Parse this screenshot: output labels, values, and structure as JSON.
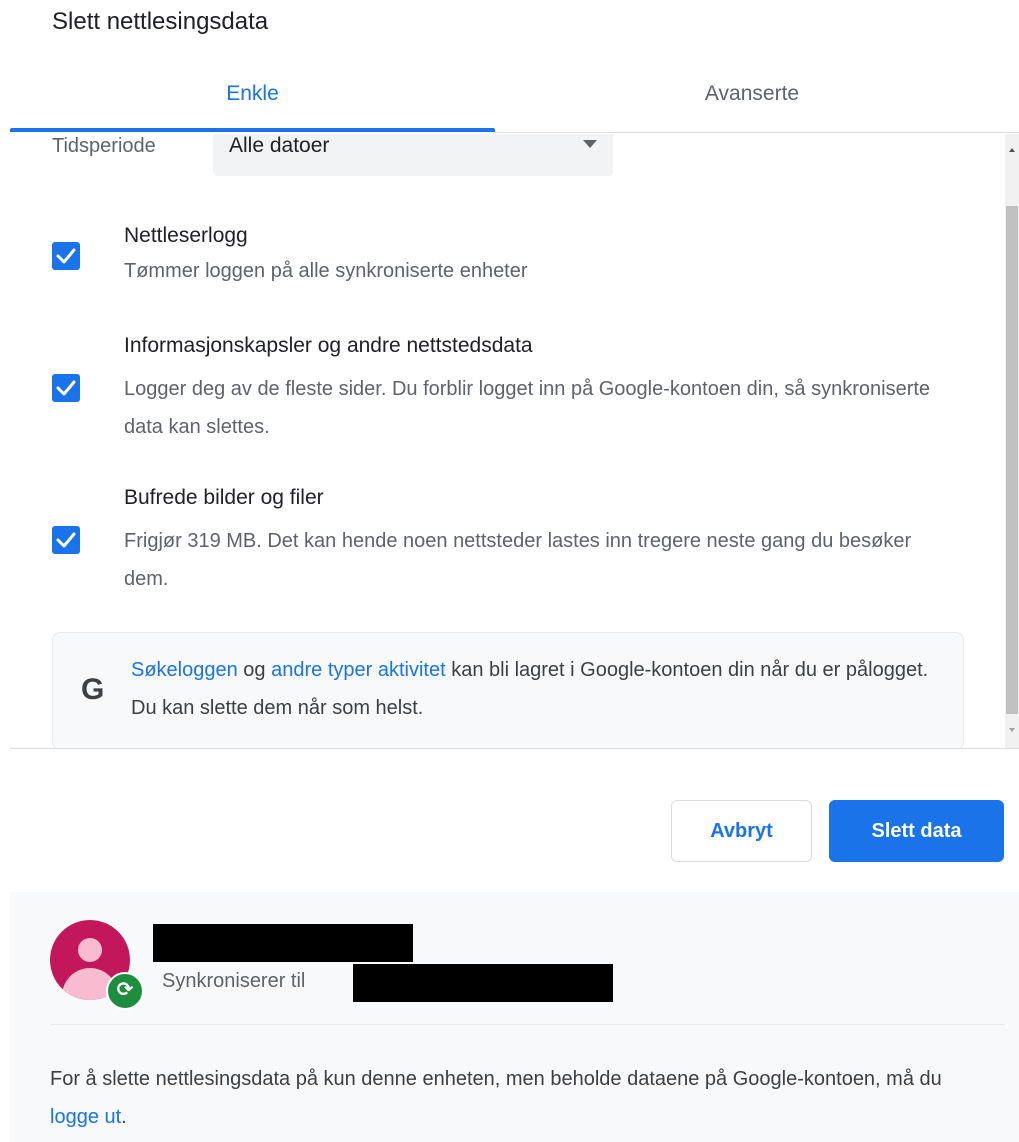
{
  "dialog": {
    "title": "Slett nettlesingsdata"
  },
  "tabs": {
    "basic": "Enkle",
    "advanced": "Avanserte",
    "active": "basic"
  },
  "time_range": {
    "label": "Tidsperiode",
    "selected": "Alle datoer"
  },
  "options": [
    {
      "title": "Nettleserlogg",
      "description": "Tømmer loggen på alle synkroniserte enheter",
      "checked": true
    },
    {
      "title": "Informasjonskapsler og andre nettstedsdata",
      "description": "Logger deg av de fleste sider. Du forblir logget inn på Google-kontoen din, så synkroniserte data kan slettes.",
      "checked": true
    },
    {
      "title": "Bufrede bilder og filer",
      "description": "Frigjør 319 MB. Det kan hende noen nettsteder lastes inn tregere neste gang du besøker dem.",
      "checked": true
    }
  ],
  "info": {
    "icon": "google-g-icon",
    "link1": "Søkeloggen",
    "text1": " og ",
    "link2": "andre typer aktivitet",
    "text2": " kan bli lagret i Google-kontoen din når du er pålogget. Du kan slette dem når som helst."
  },
  "buttons": {
    "cancel": "Avbryt",
    "delete": "Slett data"
  },
  "account": {
    "sync_label": "Synkroniserer til"
  },
  "footer": {
    "note": "For å slette nettlesingsdata på kun denne enheten, men beholde dataene på Google-kontoen, må du ",
    "link": "logge ut",
    "end": "."
  },
  "colors": {
    "accent": "#1a73e8",
    "avatar": "#c2185b",
    "sync_badge": "#1e8e3e"
  }
}
